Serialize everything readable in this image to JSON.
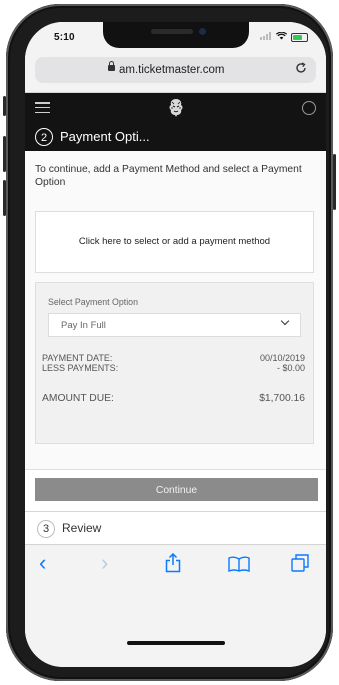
{
  "status": {
    "time": "5:10",
    "carrier_dots": "....",
    "signal": "signal-bars-icon",
    "wifi": "wifi-icon",
    "battery": "battery-icon"
  },
  "browser": {
    "url": "am.ticketmaster.com",
    "lock_icon": "lock-icon",
    "reload_icon": "reload-icon"
  },
  "navbar": {
    "menu_icon": "hamburger-menu-icon",
    "logo_icon": "lion-logo-icon",
    "profile_icon": "profile-icon"
  },
  "step": {
    "number": "2",
    "title": "Payment Opti..."
  },
  "content": {
    "instruction": "To continue, add a Payment Method and select a Payment Option",
    "payment_method_prompt": "Click here to select or add a payment method",
    "option_label": "Select Payment Option",
    "option_selected": "Pay In Full",
    "payment_date_label": "PAYMENT DATE:",
    "payment_date_value": "00/10/2019",
    "less_payments_label": "LESS PAYMENTS:",
    "less_payments_value": "- $0.00",
    "amount_due_label": "AMOUNT DUE:",
    "amount_due_value": "$1,700.16"
  },
  "continue_label": "Continue",
  "review": {
    "number": "3",
    "label": "Review"
  },
  "toolbar": {
    "back": "‹",
    "forward": "›",
    "share": "⇪",
    "bookmarks": "📖",
    "tabs": "❐"
  },
  "colors": {
    "accent": "#0a7aff",
    "header_dark": "#131313",
    "continue_disabled": "#8b8b8b"
  }
}
